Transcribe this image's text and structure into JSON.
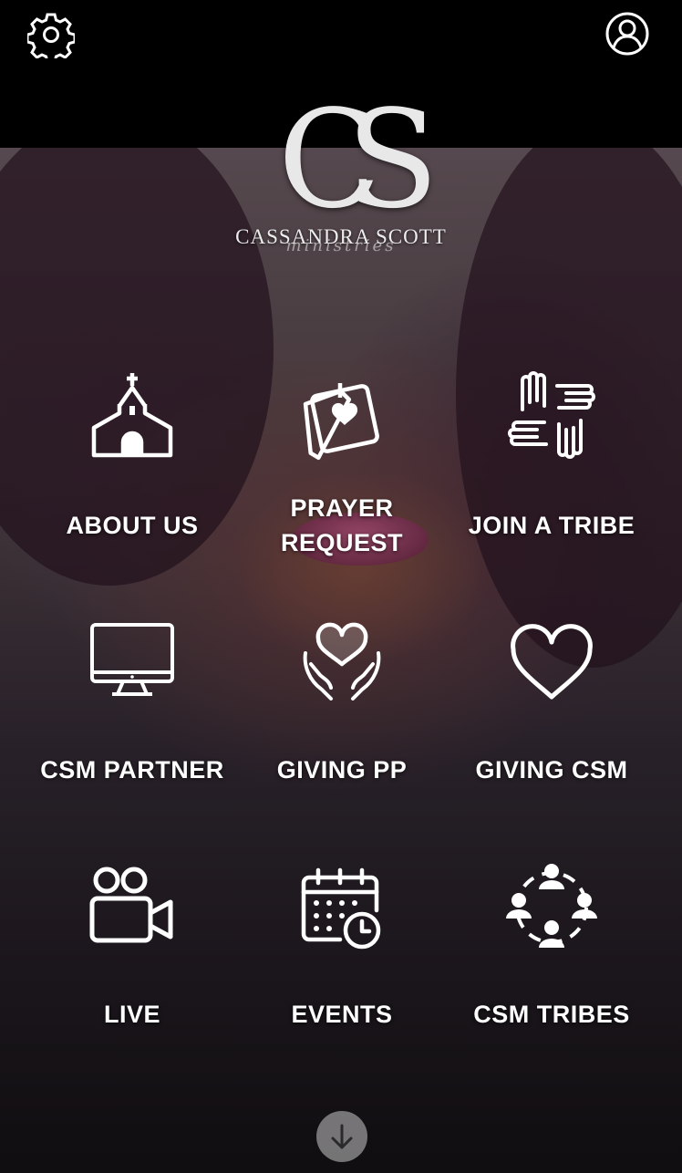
{
  "header": {
    "settings_icon": "gear-icon",
    "profile_icon": "user-circle-icon"
  },
  "logo": {
    "monogram": "CS",
    "name": "CASSANDRA SCOTT",
    "subtitle": "ministries"
  },
  "menu": [
    {
      "label": "ABOUT US",
      "icon": "church-icon"
    },
    {
      "label": "PRAYER\nREQUEST",
      "icon": "prayer-note-heart-icon"
    },
    {
      "label": "JOIN A TRIBE",
      "icon": "joined-hands-icon"
    },
    {
      "label": "CSM PARTNER",
      "icon": "monitor-icon"
    },
    {
      "label": "GIVING PP",
      "icon": "heart-hands-icon"
    },
    {
      "label": "GIVING CSM",
      "icon": "heart-icon"
    },
    {
      "label": "LIVE",
      "icon": "video-camera-icon"
    },
    {
      "label": "EVENTS",
      "icon": "calendar-clock-icon"
    },
    {
      "label": "CSM TRIBES",
      "icon": "people-circle-icon"
    }
  ],
  "scroll_button_icon": "arrow-down-icon",
  "colors": {
    "top_bar": "#000000",
    "icon_and_text": "#ffffff",
    "scroll_button": "#c8c8c8"
  }
}
